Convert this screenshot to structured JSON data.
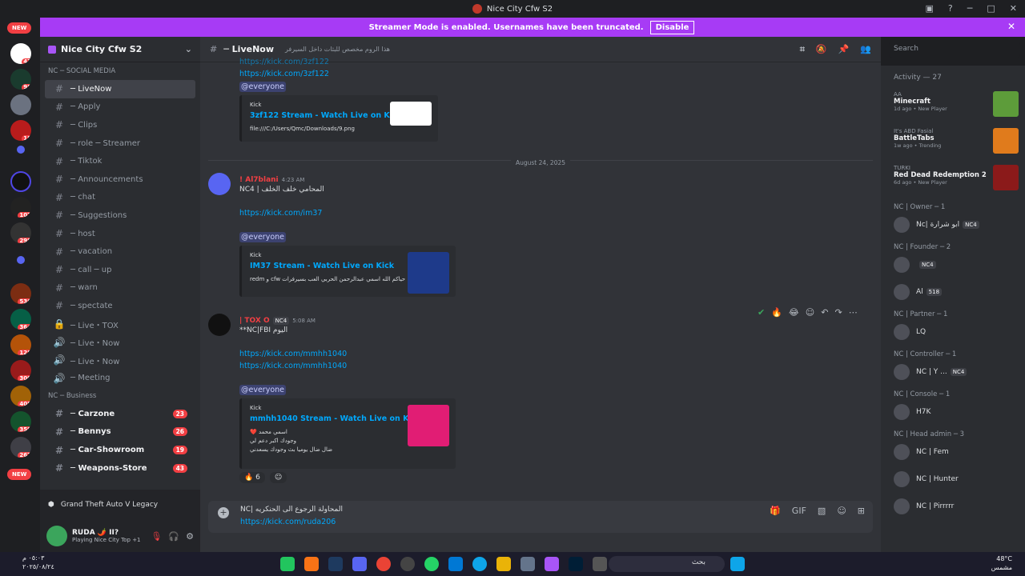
{
  "window": {
    "title": "Nice City Cfw S2"
  },
  "banner": {
    "text": "Streamer Mode is enabled. Usernames have been truncated.",
    "disable_label": "Disable"
  },
  "servers": {
    "new_top": "NEW",
    "new_bottom": "NEW",
    "badges": [
      "47",
      "98",
      "",
      "18",
      "",
      "107",
      "",
      "298",
      "",
      "536",
      "364",
      "128",
      "300",
      "408",
      "359",
      "267"
    ]
  },
  "guild": {
    "name": "Nice City Cfw S2"
  },
  "categories": {
    "social": "NC ─ SOCIAL MEDIA",
    "business": "NC ─ Business"
  },
  "channels": [
    {
      "name": "─ LiveNow",
      "active": true
    },
    {
      "name": "─ Apply"
    },
    {
      "name": "─ Clips"
    },
    {
      "name": "─ role ─ Streamer"
    },
    {
      "name": "─ Tiktok"
    },
    {
      "name": "─ Announcements"
    },
    {
      "name": "─ chat"
    },
    {
      "name": "─ Suggestions"
    },
    {
      "name": "─ host"
    },
    {
      "name": "─ vacation"
    },
    {
      "name": "─ call ─ up"
    },
    {
      "name": "─ warn"
    },
    {
      "name": "─ spectate"
    },
    {
      "name": "─ Live・TOX"
    },
    {
      "name": "─ Live・Now"
    },
    {
      "name": "─ Live・Now"
    },
    {
      "name": "─ Meeting"
    }
  ],
  "business_channels": [
    {
      "name": "─ Carzone",
      "count": "23"
    },
    {
      "name": "─ Bennys",
      "count": "26"
    },
    {
      "name": "─ Car-Showroom",
      "count": "19"
    },
    {
      "name": "─ Weapons-Store",
      "count": "43"
    }
  ],
  "activity_bar": {
    "text": "Grand Theft Auto V Legacy"
  },
  "user": {
    "name": "RUDA 🌶️ II?",
    "status": "Playing Nice City Top +1"
  },
  "channel_header": {
    "name": "─ LiveNow",
    "topic": "هذا الروم مخصص للبثات داخل السيرفر"
  },
  "search": {
    "placeholder": "Search"
  },
  "messages": {
    "m0": {
      "link_partial": "https://kick.com/3zf122",
      "link": "https://kick.com/3zf122",
      "mention": "@everyone",
      "embed_provider": "Kick",
      "embed_title": "3zf122 Stream - Watch Live on Kick",
      "embed_desc": "file:///C:/Users/Qmc/Downloads/9.png"
    },
    "date_divider": "August 24, 2025",
    "m1": {
      "author": "! Al7blani",
      "time": "4:23 AM",
      "text": "NC4 | المحامي خلف الخلف",
      "link": "https://kick.com/im37",
      "mention": "@everyone",
      "embed_provider": "Kick",
      "embed_title": "IM37 Stream - Watch Live on Kick",
      "embed_desc": "حياكم الله اسمي عبدالرحمن الحربي العب بسيرفرات cfw و redm"
    },
    "m2": {
      "author": "| TOX O",
      "tag": "NC4",
      "time": "5:08 AM",
      "text": "**NC|FBI اليوم",
      "link1": "https://kick.com/mmhh1040",
      "link2": "https://kick.com/mmhh1040",
      "mention": "@everyone",
      "embed_provider": "Kick",
      "embed_title": "mmhh1040 Stream - Watch Live on Kick",
      "embed_desc_1": "اسمي محمد ❤️",
      "embed_desc_2": "وجودك اكبر دعم لي",
      "embed_desc_3": "ضال ضال يوميا بث وجودك يسعدني",
      "reaction_count": "6"
    }
  },
  "composer": {
    "line1": "NC| المحاولة الرجوع الى الحنكريه",
    "line2": "https://kick.com/ruda206"
  },
  "members_panel": {
    "activity_head": "Activity — 27",
    "activities": [
      {
        "user": "AA",
        "game": "Minecraft",
        "meta": "1d ago • New Player",
        "color": "#5d9c3a"
      },
      {
        "user": "It's ABD Fasial",
        "game": "BattleTabs",
        "meta": "1w ago • Trending",
        "color": "#e07b1c"
      },
      {
        "user": "TURKI",
        "game": "Red Dead Redemption 2",
        "meta": "6d ago • New Player",
        "color": "#8b1a1a"
      }
    ],
    "roles": [
      {
        "title": "NC | Owner ─ 1",
        "members": [
          {
            "name": "Nc| ابو شرارة",
            "tag": "NC4"
          }
        ]
      },
      {
        "title": "NC | Founder ─ 2",
        "members": [
          {
            "name": "",
            "tag": "NC4"
          },
          {
            "name": "Al",
            "tag": "518"
          }
        ]
      },
      {
        "title": "NC | Partner ─ 1",
        "members": [
          {
            "name": "LQ",
            "tag": ""
          }
        ]
      },
      {
        "title": "NC | Controller ─ 1",
        "members": [
          {
            "name": "NC | Y ...",
            "tag": "NC4"
          }
        ]
      },
      {
        "title": "NC | Console ─ 1",
        "members": [
          {
            "name": "H7K",
            "tag": ""
          }
        ]
      },
      {
        "title": "NC | Head admin ─ 3",
        "members": [
          {
            "name": "NC | Fem",
            "tag": ""
          },
          {
            "name": "NC | Hunter",
            "tag": ""
          },
          {
            "name": "NC | Pirrrrr",
            "tag": ""
          }
        ]
      }
    ]
  },
  "taskbar": {
    "time": "٠٥:٠٣ م",
    "date": "٢٠٢٥/٠٨/٢٤",
    "search_placeholder": "بحث",
    "temp": "48°C",
    "weather": "مشمس"
  }
}
